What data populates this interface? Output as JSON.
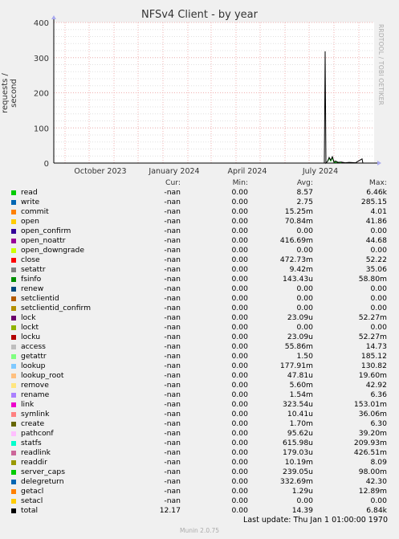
{
  "title": "NFSv4 Client - by year",
  "ylabel": "requests / second",
  "watermark": "RRDTOOL / TOBI OETIKER",
  "legend_header": {
    "cur": "Cur:",
    "min": "Min:",
    "avg": "Avg:",
    "max": "Max:"
  },
  "legend": [
    {
      "name": "read",
      "cur": "-nan",
      "min": "0.00",
      "avg": "8.57",
      "max": "6.46k",
      "color": "#00cc00"
    },
    {
      "name": "write",
      "cur": "-nan",
      "min": "0.00",
      "avg": "2.75",
      "max": "285.15",
      "color": "#0066b3"
    },
    {
      "name": "commit",
      "cur": "-nan",
      "min": "0.00",
      "avg": "15.25m",
      "max": "4.01",
      "color": "#ff8000"
    },
    {
      "name": "open",
      "cur": "-nan",
      "min": "0.00",
      "avg": "70.84m",
      "max": "41.86",
      "color": "#ffcc00"
    },
    {
      "name": "open_confirm",
      "cur": "-nan",
      "min": "0.00",
      "avg": "0.00",
      "max": "0.00",
      "color": "#330099"
    },
    {
      "name": "open_noattr",
      "cur": "-nan",
      "min": "0.00",
      "avg": "416.69m",
      "max": "44.68",
      "color": "#990099"
    },
    {
      "name": "open_downgrade",
      "cur": "-nan",
      "min": "0.00",
      "avg": "0.00",
      "max": "0.00",
      "color": "#ccff00"
    },
    {
      "name": "close",
      "cur": "-nan",
      "min": "0.00",
      "avg": "472.73m",
      "max": "52.22",
      "color": "#ff0000"
    },
    {
      "name": "setattr",
      "cur": "-nan",
      "min": "0.00",
      "avg": "9.42m",
      "max": "35.06",
      "color": "#808080"
    },
    {
      "name": "fsinfo",
      "cur": "-nan",
      "min": "0.00",
      "avg": "143.43u",
      "max": "58.80m",
      "color": "#008f00"
    },
    {
      "name": "renew",
      "cur": "-nan",
      "min": "0.00",
      "avg": "0.00",
      "max": "0.00",
      "color": "#00487d"
    },
    {
      "name": "setclientid",
      "cur": "-nan",
      "min": "0.00",
      "avg": "0.00",
      "max": "0.00",
      "color": "#b35a00"
    },
    {
      "name": "setclientid_confirm",
      "cur": "-nan",
      "min": "0.00",
      "avg": "0.00",
      "max": "0.00",
      "color": "#b38f00"
    },
    {
      "name": "lock",
      "cur": "-nan",
      "min": "0.00",
      "avg": "23.09u",
      "max": "52.27m",
      "color": "#6b006b"
    },
    {
      "name": "lockt",
      "cur": "-nan",
      "min": "0.00",
      "avg": "0.00",
      "max": "0.00",
      "color": "#8fb300"
    },
    {
      "name": "locku",
      "cur": "-nan",
      "min": "0.00",
      "avg": "23.09u",
      "max": "52.27m",
      "color": "#b30000"
    },
    {
      "name": "access",
      "cur": "-nan",
      "min": "0.00",
      "avg": "55.86m",
      "max": "14.73",
      "color": "#bebebe"
    },
    {
      "name": "getattr",
      "cur": "-nan",
      "min": "0.00",
      "avg": "1.50",
      "max": "185.12",
      "color": "#80ff80"
    },
    {
      "name": "lookup",
      "cur": "-nan",
      "min": "0.00",
      "avg": "177.91m",
      "max": "130.82",
      "color": "#80c9ff"
    },
    {
      "name": "lookup_root",
      "cur": "-nan",
      "min": "0.00",
      "avg": "47.81u",
      "max": "19.60m",
      "color": "#ffc080"
    },
    {
      "name": "remove",
      "cur": "-nan",
      "min": "0.00",
      "avg": "5.60m",
      "max": "42.92",
      "color": "#ffe680"
    },
    {
      "name": "rename",
      "cur": "-nan",
      "min": "0.00",
      "avg": "1.54m",
      "max": "6.36",
      "color": "#aa80ff"
    },
    {
      "name": "link",
      "cur": "-nan",
      "min": "0.00",
      "avg": "323.54u",
      "max": "153.01m",
      "color": "#ee00cc"
    },
    {
      "name": "symlink",
      "cur": "-nan",
      "min": "0.00",
      "avg": "10.41u",
      "max": "36.06m",
      "color": "#ff8080"
    },
    {
      "name": "create",
      "cur": "-nan",
      "min": "0.00",
      "avg": "1.70m",
      "max": "6.30",
      "color": "#666600"
    },
    {
      "name": "pathconf",
      "cur": "-nan",
      "min": "0.00",
      "avg": "95.62u",
      "max": "39.20m",
      "color": "#ffbfff"
    },
    {
      "name": "statfs",
      "cur": "-nan",
      "min": "0.00",
      "avg": "615.98u",
      "max": "209.93m",
      "color": "#00ffcc"
    },
    {
      "name": "readlink",
      "cur": "-nan",
      "min": "0.00",
      "avg": "179.03u",
      "max": "426.51m",
      "color": "#cc6699"
    },
    {
      "name": "readdir",
      "cur": "-nan",
      "min": "0.00",
      "avg": "10.19m",
      "max": "8.09",
      "color": "#999900"
    },
    {
      "name": "server_caps",
      "cur": "-nan",
      "min": "0.00",
      "avg": "239.05u",
      "max": "98.00m",
      "color": "#00cc00"
    },
    {
      "name": "delegreturn",
      "cur": "-nan",
      "min": "0.00",
      "avg": "332.69m",
      "max": "42.30",
      "color": "#0066b3"
    },
    {
      "name": "getacl",
      "cur": "-nan",
      "min": "0.00",
      "avg": "1.29u",
      "max": "12.89m",
      "color": "#ff8000"
    },
    {
      "name": "setacl",
      "cur": "-nan",
      "min": "0.00",
      "avg": "0.00",
      "max": "0.00",
      "color": "#ffcc00"
    },
    {
      "name": "total",
      "cur": "12.17",
      "min": "0.00",
      "avg": "14.39",
      "max": "6.84k",
      "color": "#000000"
    }
  ],
  "footer": "Last update: Thu Jan  1 01:00:00 1970",
  "munin_version": "Munin 2.0.75",
  "chart_data": {
    "type": "line",
    "title": "NFSv4 Client - by year",
    "ylabel": "requests / second",
    "ylim": [
      0,
      400
    ],
    "yticks": [
      0,
      100,
      200,
      300,
      400
    ],
    "xticks": [
      "October 2023",
      "January 2024",
      "April 2024",
      "July 2024"
    ],
    "grid": true,
    "series": [
      {
        "name": "total",
        "color": "#000000",
        "points": [
          [
            "2024-07-20",
            0
          ],
          [
            "2024-07-21",
            318
          ],
          [
            "2024-07-22",
            0
          ],
          [
            "2024-07-24",
            5
          ],
          [
            "2024-07-26",
            16
          ],
          [
            "2024-07-28",
            8
          ],
          [
            "2024-07-30",
            18
          ],
          [
            "2024-08-01",
            3
          ],
          [
            "2024-08-03",
            6
          ],
          [
            "2024-08-06",
            2
          ],
          [
            "2024-08-10",
            3
          ],
          [
            "2024-08-15",
            1
          ],
          [
            "2024-08-20",
            2
          ],
          [
            "2024-08-28",
            1
          ],
          [
            "2024-09-05",
            12
          ],
          [
            "2024-09-06",
            0
          ]
        ]
      },
      {
        "name": "read",
        "color": "#00cc00",
        "points": [
          [
            "2024-07-24",
            4
          ],
          [
            "2024-07-26",
            14
          ],
          [
            "2024-07-28",
            6
          ],
          [
            "2024-07-30",
            15
          ],
          [
            "2024-08-01",
            2
          ],
          [
            "2024-08-05",
            3
          ],
          [
            "2024-08-10",
            1
          ]
        ]
      }
    ]
  }
}
